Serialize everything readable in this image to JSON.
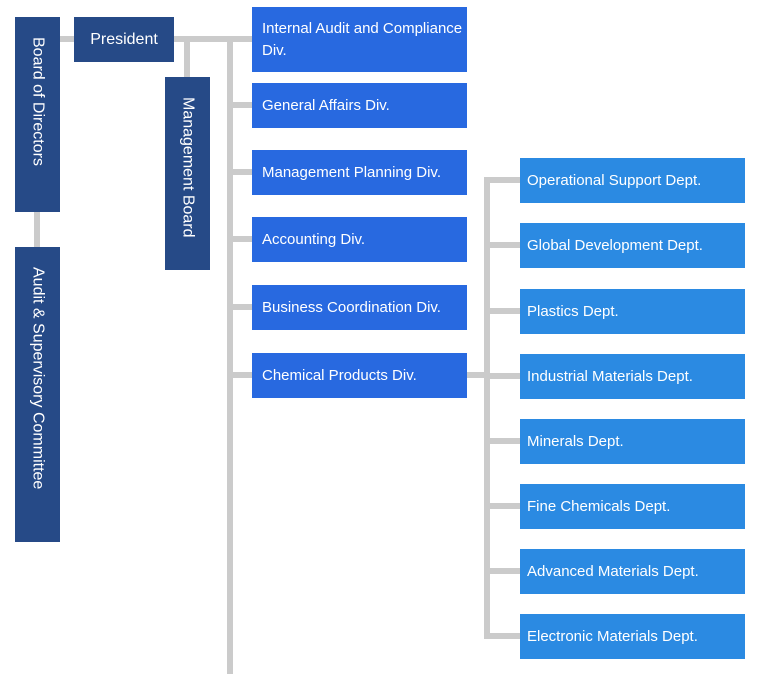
{
  "board": "Board of Directors",
  "president": "President",
  "management_board": "Management Board",
  "audit_committee": "Audit & Supervisory Committee",
  "divisions": [
    "Internal Audit and Compliance Div.",
    "General Affairs Div.",
    "Management Planning Div.",
    "Accounting Div.",
    "Business Coordination Div.",
    "Chemical Products Div."
  ],
  "departments": [
    "Operational Support Dept.",
    "Global Development Dept.",
    "Plastics Dept.",
    "Industrial Materials Dept.",
    "Minerals Dept.",
    "Fine Chemicals Dept.",
    "Advanced Materials Dept.",
    "Electronic Materials Dept."
  ],
  "colors": {
    "executive": "#264a87",
    "division": "#2869e0",
    "department": "#2b8ae2",
    "connector": "#cbcbcb"
  }
}
